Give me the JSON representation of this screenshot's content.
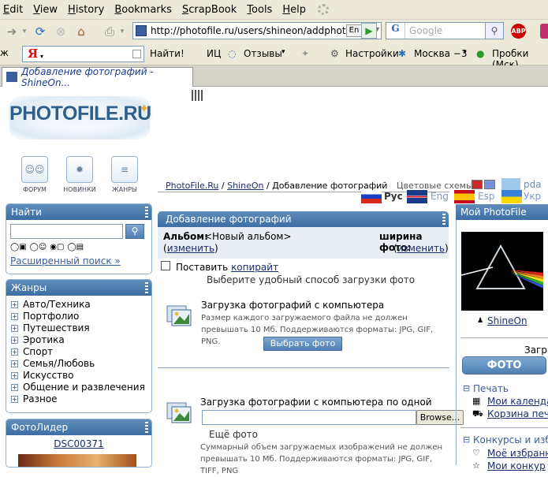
{
  "browser": {
    "menu": [
      "Edit",
      "View",
      "History",
      "Bookmarks",
      "ScrapBook",
      "Tools",
      "Help"
    ],
    "url": "http://photofile.ru/users/shineon/addphoto/",
    "lang_badge": "En",
    "search_placeholder": "Google",
    "abp": "ABP",
    "yandex": {
      "logo": "Я",
      "find": "Найти!",
      "ic": "ИЦ",
      "reviews": "Отзывы",
      "settings": "Настройки",
      "weather": "Москва −3",
      "traffic": "Пробки (Мск)"
    },
    "tab_title": "Добавление фотографий - ShineOn..."
  },
  "site": {
    "logo": "PHOTOFILE.RU",
    "nav": [
      "ФОРУМ",
      "НОВИНКИ",
      "ЖАНРЫ"
    ],
    "breadcrumb": {
      "home": "PhotoFile.Ru",
      "sep1": " / ",
      "user": "ShineOn",
      "sep2": " / ",
      "current": "Добавление фотографий"
    },
    "color_schemes_label": "Цветовые схемы:",
    "pda": "pda",
    "languages": [
      {
        "label": "Рус",
        "active": true
      },
      {
        "label": "Eng",
        "active": false
      },
      {
        "label": "Esp",
        "active": false
      },
      {
        "label": "Укр",
        "active": false
      }
    ]
  },
  "search_box": {
    "title": "Найти",
    "advanced": "Расширенный поиск"
  },
  "genres": {
    "title": "Жанры",
    "items": [
      "Авто/Техника",
      "Портфолио",
      "Путешествия",
      "Эротика",
      "Спорт",
      "Семья/Любовь",
      "Искусство",
      "Общение и развлечения",
      "Разное"
    ]
  },
  "leader": {
    "title": "ФотоЛидер",
    "name": "DSC00371"
  },
  "main": {
    "title": "Добавление фотографий",
    "album_label": "Альбом:",
    "album_value": "<Новый альбом>",
    "change1": "изменить",
    "width_label": "ширина фото:",
    "change2": "изменить",
    "copyright_prefix": "Поставить ",
    "copyright_link": "копирайт",
    "choose_method": "Выберите удобный способ загрузки фото",
    "upload1_title": "Загрузка фотографий с компьютера",
    "upload1_desc": "Размер каждого загружаемого файла не должен превышать 10 Мб. Поддерживаются форматы: JPG, GIF, PNG.",
    "choose_button": "Выбрать фото",
    "upload2_title": "Загрузка фотографии с компьютера по одной",
    "browse": "Browse...",
    "more_photo": "Ещё фото",
    "upload2_desc": "Суммарный объем загружаемых изображений не должен превышать 10 Мб. Поддерживаются форматы: JPG, GIF, TIFF, PNG"
  },
  "right": {
    "title": "Мой PhotoFile",
    "user": "ShineOn",
    "upload_label": "Загр",
    "photo_button": "ФОТО",
    "print": "Печать",
    "calendar": "Мои календа",
    "cart": "Корзина печа",
    "contests": "Конкурсы и избр",
    "favorites": "Моё избранн",
    "more": "Мои конкур"
  }
}
